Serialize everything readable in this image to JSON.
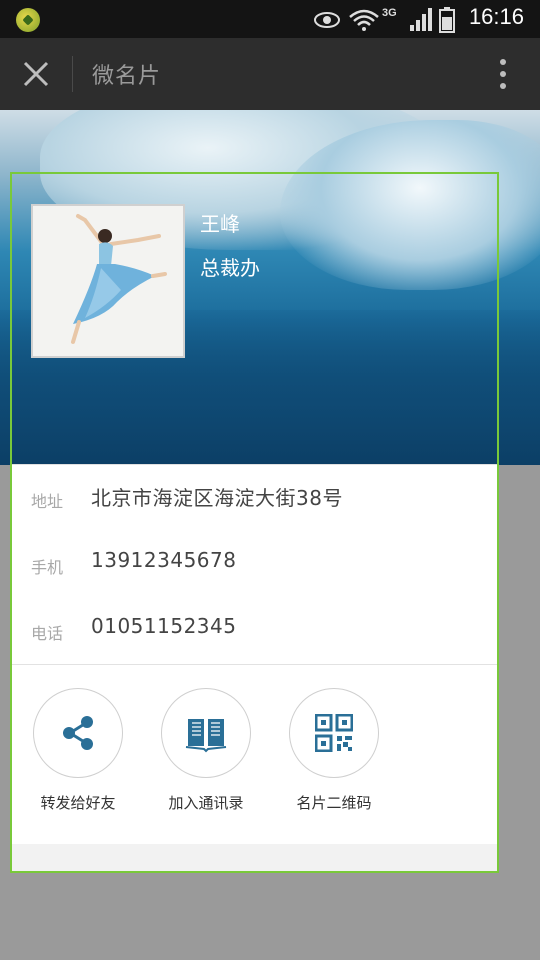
{
  "status_bar": {
    "time": "16:16",
    "network": "3G",
    "icons": [
      "app-icon",
      "eye-icon",
      "wifi-icon",
      "signal-icon",
      "battery-icon"
    ]
  },
  "title_bar": {
    "title": "微名片",
    "icons": [
      "close-icon",
      "more-vertical-icon"
    ]
  },
  "card": {
    "name": "王峰",
    "department": "总裁办",
    "info": [
      {
        "label": "地址",
        "value": "北京市海淀区海淀大街38号"
      },
      {
        "label": "手机",
        "value": "13912345678"
      },
      {
        "label": "电话",
        "value": "01051152345"
      }
    ],
    "actions": [
      {
        "label": "转发给好友",
        "icon": "share-icon"
      },
      {
        "label": "加入通讯录",
        "icon": "book-icon"
      },
      {
        "label": "名片二维码",
        "icon": "qr-code-icon"
      }
    ]
  },
  "colors": {
    "accent": "#2a6f97",
    "border_highlight": "#79c93a",
    "title_bar": "#2d2d2d"
  }
}
